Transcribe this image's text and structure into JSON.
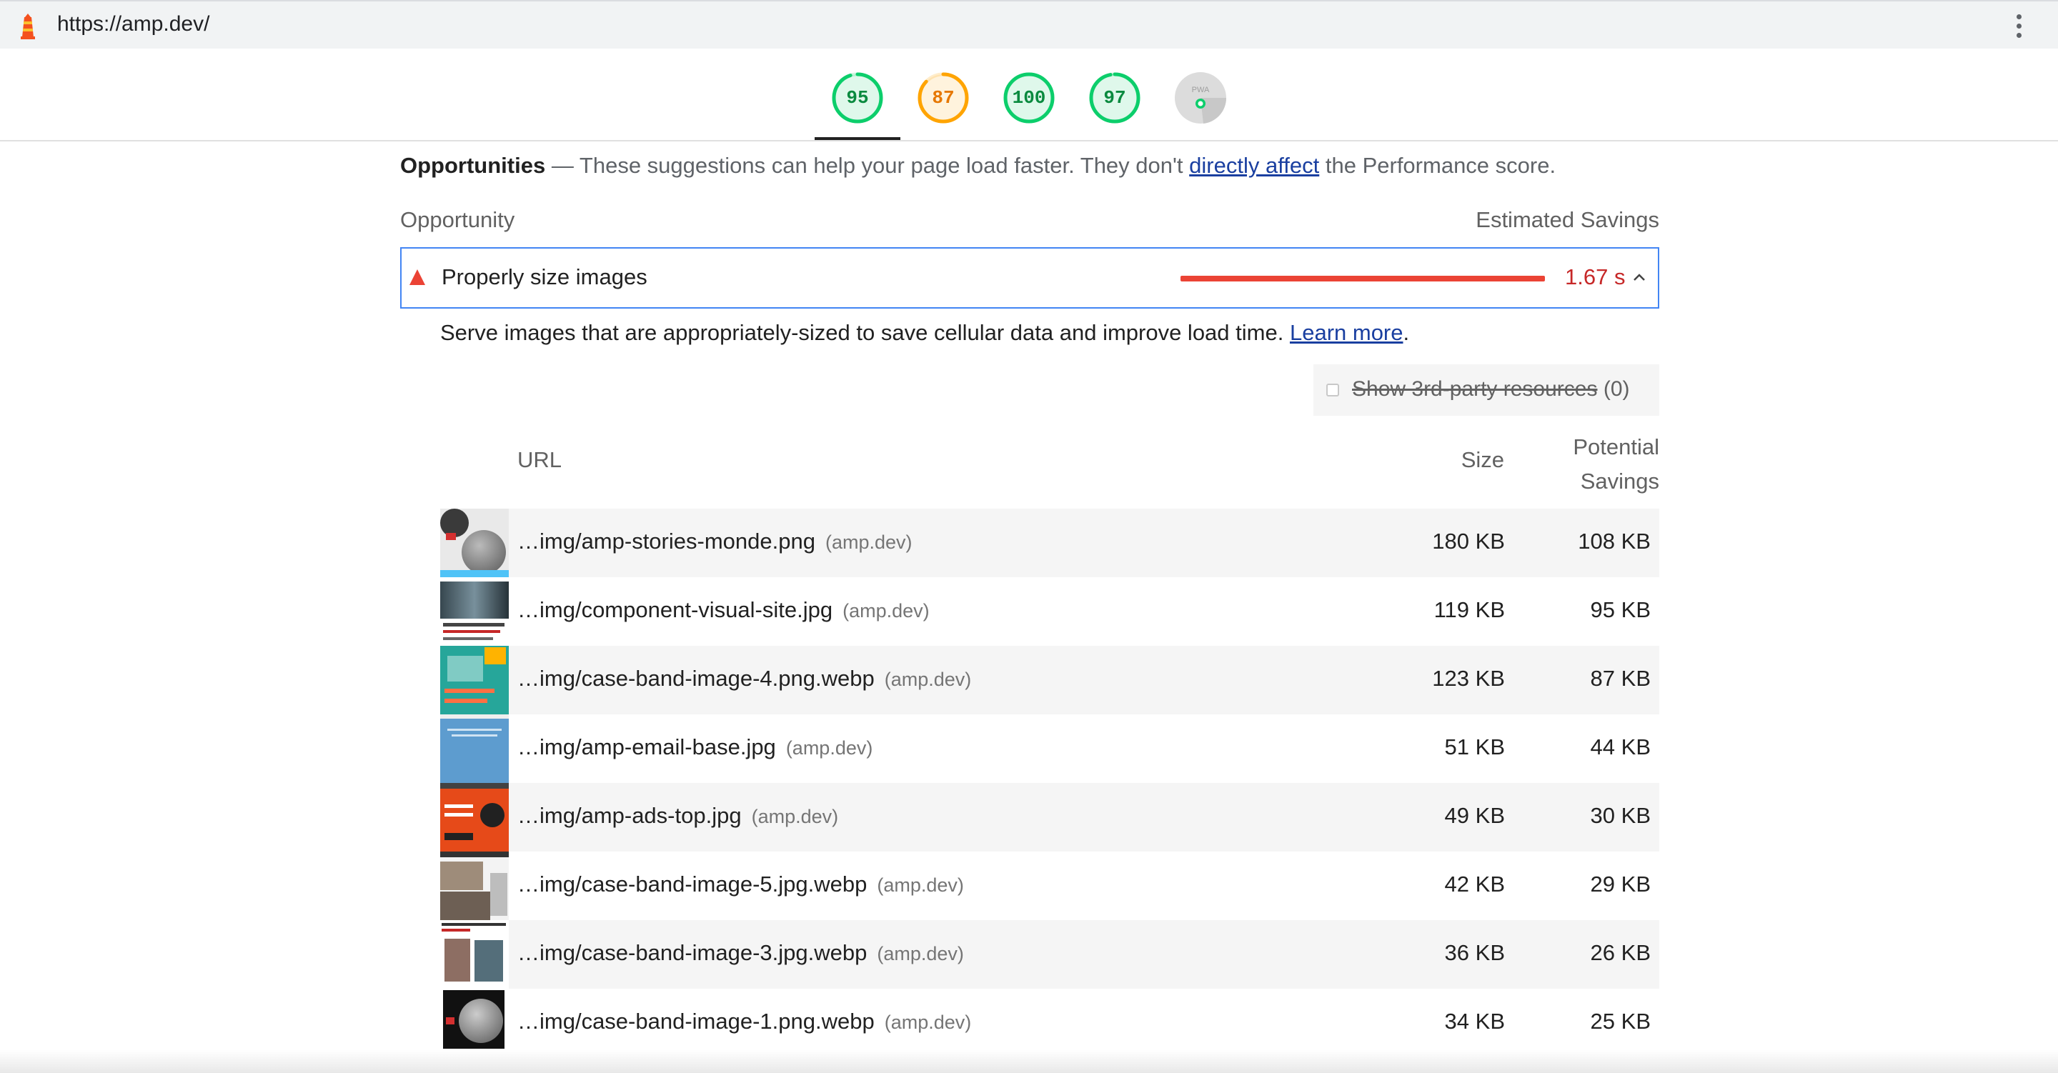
{
  "browser": {
    "url": "https://amp.dev/"
  },
  "scores": [
    {
      "value": "95",
      "color": "#0cce6b",
      "text_color": "#0a8a3f",
      "fraction": 0.95
    },
    {
      "value": "87",
      "color": "#ffa400",
      "text_color": "#e67700",
      "fraction": 0.87
    },
    {
      "value": "100",
      "color": "#0cce6b",
      "text_color": "#0a8a3f",
      "fraction": 1.0
    },
    {
      "value": "97",
      "color": "#0cce6b",
      "text_color": "#0a8a3f",
      "fraction": 0.97
    },
    {
      "value": "PWA",
      "color": "#bdbdbd",
      "text_color": "#9e9e9e",
      "fraction": 0.0
    }
  ],
  "section": {
    "title": "Opportunities",
    "dash": "—",
    "description_pre": "These suggestions can help your page load faster. They don't",
    "link": "directly affect",
    "description_post": "the Performance score."
  },
  "columns": {
    "opportunity": "Opportunity",
    "savings": "Estimated Savings"
  },
  "audit": {
    "title": "Properly size images",
    "savings": "1.67 s",
    "description": "Serve images that are appropriately-sized to save cellular data and improve load time.",
    "learn_more": "Learn more",
    "period": "."
  },
  "filter": {
    "label": "Show 3rd-party resources",
    "count": "(0)"
  },
  "table": {
    "headers": {
      "url": "URL",
      "size": "Size",
      "potential_line1": "Potential",
      "potential_line2": "Savings"
    },
    "rows": [
      {
        "url": "…img/amp-stories-monde.png",
        "host": "(amp.dev)",
        "size": "180 KB",
        "savings": "108 KB"
      },
      {
        "url": "…img/component-visual-site.jpg",
        "host": "(amp.dev)",
        "size": "119 KB",
        "savings": "95 KB"
      },
      {
        "url": "…img/case-band-image-4.png.webp",
        "host": "(amp.dev)",
        "size": "123 KB",
        "savings": "87 KB"
      },
      {
        "url": "…img/amp-email-base.jpg",
        "host": "(amp.dev)",
        "size": "51 KB",
        "savings": "44 KB"
      },
      {
        "url": "…img/amp-ads-top.jpg",
        "host": "(amp.dev)",
        "size": "49 KB",
        "savings": "30 KB"
      },
      {
        "url": "…img/case-band-image-5.jpg.webp",
        "host": "(amp.dev)",
        "size": "42 KB",
        "savings": "29 KB"
      },
      {
        "url": "…img/case-band-image-3.jpg.webp",
        "host": "(amp.dev)",
        "size": "36 KB",
        "savings": "26 KB"
      },
      {
        "url": "…img/case-band-image-1.png.webp",
        "host": "(amp.dev)",
        "size": "34 KB",
        "savings": "25 KB"
      }
    ]
  }
}
